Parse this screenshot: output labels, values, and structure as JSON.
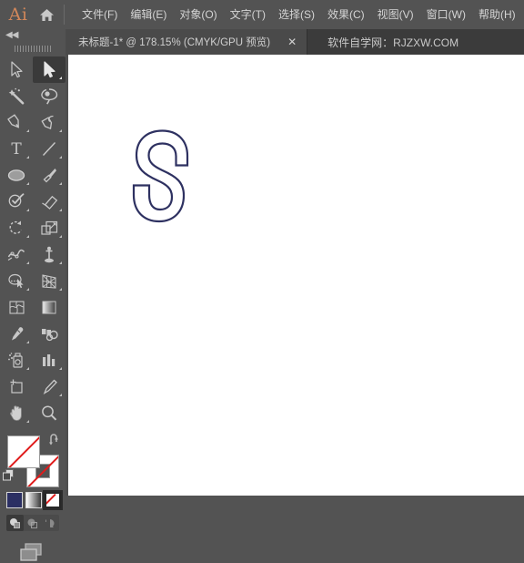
{
  "app": {
    "logo_text": "Ai",
    "home_icon": "home-icon"
  },
  "menubar": {
    "items": [
      {
        "label": "文件(F)",
        "name": "menu-file"
      },
      {
        "label": "编辑(E)",
        "name": "menu-edit"
      },
      {
        "label": "对象(O)",
        "name": "menu-object"
      },
      {
        "label": "文字(T)",
        "name": "menu-type"
      },
      {
        "label": "选择(S)",
        "name": "menu-select"
      },
      {
        "label": "效果(C)",
        "name": "menu-effect"
      },
      {
        "label": "视图(V)",
        "name": "menu-view"
      },
      {
        "label": "窗口(W)",
        "name": "menu-window"
      },
      {
        "label": "帮助(H)",
        "name": "menu-help"
      }
    ]
  },
  "tabbar": {
    "document_tab": {
      "title": "未标题-1* @ 178.15% (CMYK/GPU 预览)",
      "close_label": "✕",
      "zoom_level": "178.15%",
      "color_mode": "CMYK",
      "preview_mode": "GPU 预览",
      "document_name": "未标题-1*"
    },
    "watermark": "软件自学网：RJZXW.COM"
  },
  "toolbar": {
    "collapse_label": "◀◀",
    "grip": "drag-grip",
    "tools": [
      {
        "name": "selection-tool",
        "label": "选择工具",
        "active": false,
        "has_flyout": false
      },
      {
        "name": "direct-selection-tool",
        "label": "直接选择工具",
        "active": true,
        "has_flyout": true
      },
      {
        "name": "magic-wand-tool",
        "label": "魔棒工具",
        "active": false,
        "has_flyout": false
      },
      {
        "name": "lasso-tool",
        "label": "套索工具",
        "active": false,
        "has_flyout": false
      },
      {
        "name": "pen-tool",
        "label": "钢笔工具",
        "active": false,
        "has_flyout": true
      },
      {
        "name": "curvature-tool",
        "label": "曲率工具",
        "active": false,
        "has_flyout": true
      },
      {
        "name": "type-tool",
        "label": "文字工具",
        "active": false,
        "has_flyout": true
      },
      {
        "name": "line-segment-tool",
        "label": "直线段工具",
        "active": false,
        "has_flyout": true
      },
      {
        "name": "ellipse-tool",
        "label": "椭圆工具",
        "active": false,
        "has_flyout": true
      },
      {
        "name": "paintbrush-tool",
        "label": "画笔工具",
        "active": false,
        "has_flyout": true
      },
      {
        "name": "shaper-tool",
        "label": "Shaper 工具",
        "active": false,
        "has_flyout": true
      },
      {
        "name": "eraser-tool",
        "label": "橡皮擦工具",
        "active": false,
        "has_flyout": true
      },
      {
        "name": "rotate-tool",
        "label": "旋转工具",
        "active": false,
        "has_flyout": true
      },
      {
        "name": "scale-tool",
        "label": "比例缩放工具",
        "active": false,
        "has_flyout": true
      },
      {
        "name": "width-tool",
        "label": "宽度工具",
        "active": false,
        "has_flyout": true
      },
      {
        "name": "free-transform-tool",
        "label": "自由变换工具",
        "active": false,
        "has_flyout": true
      },
      {
        "name": "shape-builder-tool",
        "label": "形状生成器工具",
        "active": false,
        "has_flyout": true
      },
      {
        "name": "perspective-grid-tool",
        "label": "透视网格工具",
        "active": false,
        "has_flyout": true
      },
      {
        "name": "mesh-tool",
        "label": "网格工具",
        "active": false,
        "has_flyout": false
      },
      {
        "name": "gradient-tool",
        "label": "渐变工具",
        "active": false,
        "has_flyout": false
      },
      {
        "name": "eyedropper-tool",
        "label": "吸管工具",
        "active": false,
        "has_flyout": true
      },
      {
        "name": "blend-tool",
        "label": "混合工具",
        "active": false,
        "has_flyout": false
      },
      {
        "name": "symbol-sprayer-tool",
        "label": "符号喷枪工具",
        "active": false,
        "has_flyout": true
      },
      {
        "name": "column-graph-tool",
        "label": "柱形图工具",
        "active": false,
        "has_flyout": true
      },
      {
        "name": "artboard-tool",
        "label": "画板工具",
        "active": false,
        "has_flyout": false
      },
      {
        "name": "slice-tool",
        "label": "切片工具",
        "active": false,
        "has_flyout": true
      },
      {
        "name": "hand-tool",
        "label": "抓手工具",
        "active": false,
        "has_flyout": true
      },
      {
        "name": "zoom-tool",
        "label": "缩放工具",
        "active": false,
        "has_flyout": false
      }
    ],
    "fill_stroke": {
      "fill_label": "填色",
      "fill_value": "无",
      "stroke_label": "描边",
      "stroke_value": "无",
      "swap_label": "互换填色和描边",
      "default_label": "默认填色和描边"
    },
    "color_modes": [
      {
        "name": "color-button",
        "label": "颜色",
        "selected": false
      },
      {
        "name": "gradient-button",
        "label": "渐变",
        "selected": false
      },
      {
        "name": "none-button",
        "label": "无",
        "selected": true
      }
    ],
    "draw_modes": [
      {
        "name": "draw-normal-button",
        "label": "正常绘图",
        "selected": true
      },
      {
        "name": "draw-behind-button",
        "label": "背面绘图",
        "selected": false
      },
      {
        "name": "draw-inside-button",
        "label": "内部绘图",
        "selected": false
      }
    ],
    "screen_mode": {
      "name": "screen-mode-button",
      "label": "更改屏幕模式"
    }
  },
  "canvas": {
    "background": "#ffffff",
    "artwork": {
      "name": "letter-s-outline",
      "character": "S",
      "stroke_color": "#2e3161",
      "fill": "none",
      "stroke_width": 2
    }
  },
  "colors": {
    "app_chrome": "#535353",
    "tabbar": "#3b3b3b",
    "active_tab": "#4a4a4a",
    "accent_orange": "#d2875a",
    "artwork_navy": "#2e3161",
    "none_red": "#e01b1b"
  }
}
